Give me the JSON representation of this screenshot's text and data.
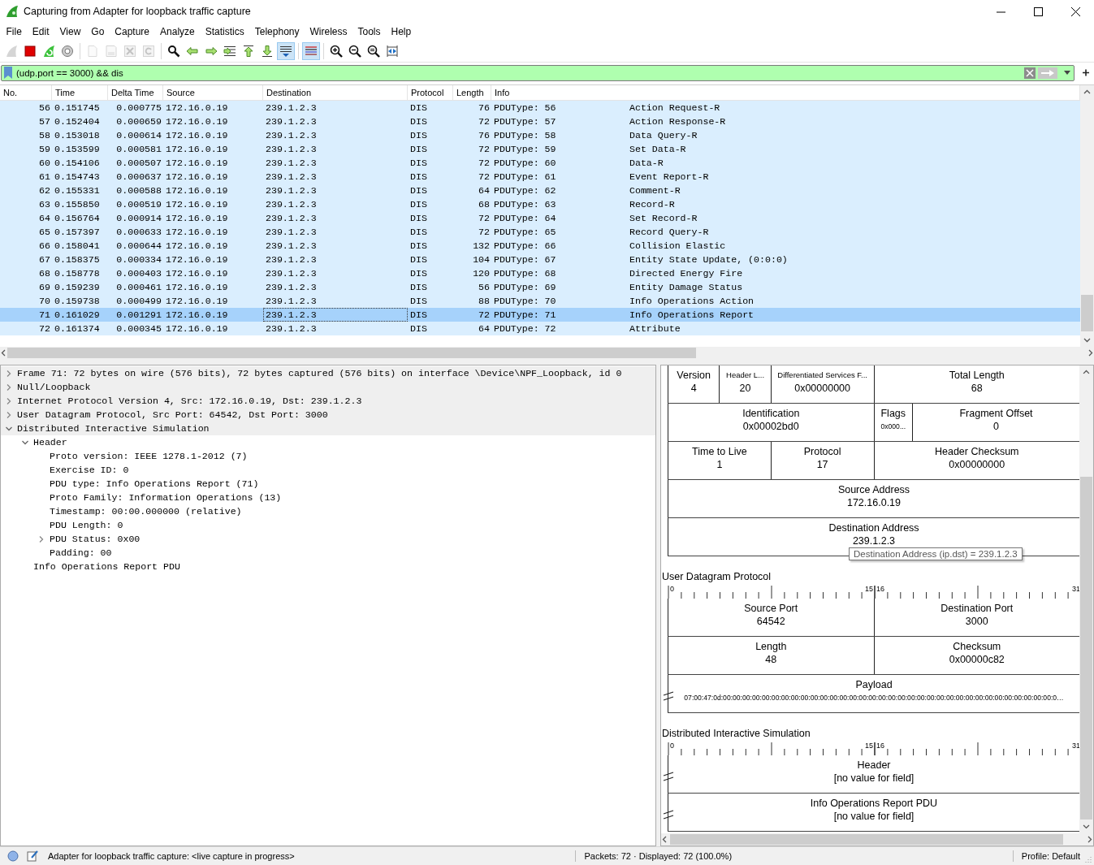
{
  "window": {
    "title": "Capturing from Adapter for loopback traffic capture"
  },
  "menu": [
    "File",
    "Edit",
    "View",
    "Go",
    "Capture",
    "Analyze",
    "Statistics",
    "Telephony",
    "Wireless",
    "Tools",
    "Help"
  ],
  "toolbar": [
    {
      "kind": "start",
      "disabled": true,
      "on": false
    },
    {
      "kind": "stop",
      "disabled": false,
      "on": false
    },
    {
      "kind": "restart",
      "disabled": false,
      "on": false
    },
    {
      "kind": "options",
      "disabled": false,
      "on": false
    },
    {
      "kind": "separator"
    },
    {
      "kind": "open",
      "disabled": true,
      "on": false
    },
    {
      "kind": "save",
      "disabled": true,
      "on": false
    },
    {
      "kind": "close",
      "disabled": true,
      "on": false
    },
    {
      "kind": "reload",
      "disabled": true,
      "on": false
    },
    {
      "kind": "separator"
    },
    {
      "kind": "find",
      "disabled": false,
      "on": false
    },
    {
      "kind": "back",
      "disabled": false,
      "on": false
    },
    {
      "kind": "forward",
      "disabled": false,
      "on": false
    },
    {
      "kind": "goto",
      "disabled": false,
      "on": false
    },
    {
      "kind": "first",
      "disabled": false,
      "on": false
    },
    {
      "kind": "last",
      "disabled": false,
      "on": false
    },
    {
      "kind": "autoscroll",
      "disabled": false,
      "on": true
    },
    {
      "kind": "separator"
    },
    {
      "kind": "colorize",
      "disabled": false,
      "on": true
    },
    {
      "kind": "separator"
    },
    {
      "kind": "zoom_in",
      "disabled": false,
      "on": false
    },
    {
      "kind": "zoom_out",
      "disabled": false,
      "on": false
    },
    {
      "kind": "zoom_normal",
      "disabled": false,
      "on": false
    },
    {
      "kind": "resize",
      "disabled": false,
      "on": false
    }
  ],
  "filter": {
    "value": "(udp.port == 3000) && dis"
  },
  "packet_list": {
    "columns": [
      "No.",
      "Time",
      "Delta Time",
      "Source",
      "Destination",
      "Protocol",
      "Length",
      "Info"
    ],
    "rows": [
      {
        "no": "56",
        "time": "0.151745",
        "delta_time": "0.000775",
        "source": "172.16.0.19",
        "destination": "239.1.2.3",
        "protocol": "DIS",
        "length": "76",
        "info_type": "PDUType: 56",
        "info_name": "Action Request-R",
        "selected": false
      },
      {
        "no": "57",
        "time": "0.152404",
        "delta_time": "0.000659",
        "source": "172.16.0.19",
        "destination": "239.1.2.3",
        "protocol": "DIS",
        "length": "72",
        "info_type": "PDUType: 57",
        "info_name": "Action Response-R",
        "selected": false
      },
      {
        "no": "58",
        "time": "0.153018",
        "delta_time": "0.000614",
        "source": "172.16.0.19",
        "destination": "239.1.2.3",
        "protocol": "DIS",
        "length": "76",
        "info_type": "PDUType: 58",
        "info_name": "Data Query-R",
        "selected": false
      },
      {
        "no": "59",
        "time": "0.153599",
        "delta_time": "0.000581",
        "source": "172.16.0.19",
        "destination": "239.1.2.3",
        "protocol": "DIS",
        "length": "72",
        "info_type": "PDUType: 59",
        "info_name": "Set Data-R",
        "selected": false
      },
      {
        "no": "60",
        "time": "0.154106",
        "delta_time": "0.000507",
        "source": "172.16.0.19",
        "destination": "239.1.2.3",
        "protocol": "DIS",
        "length": "72",
        "info_type": "PDUType: 60",
        "info_name": "Data-R",
        "selected": false
      },
      {
        "no": "61",
        "time": "0.154743",
        "delta_time": "0.000637",
        "source": "172.16.0.19",
        "destination": "239.1.2.3",
        "protocol": "DIS",
        "length": "72",
        "info_type": "PDUType: 61",
        "info_name": "Event Report-R",
        "selected": false
      },
      {
        "no": "62",
        "time": "0.155331",
        "delta_time": "0.000588",
        "source": "172.16.0.19",
        "destination": "239.1.2.3",
        "protocol": "DIS",
        "length": "64",
        "info_type": "PDUType: 62",
        "info_name": "Comment-R",
        "selected": false
      },
      {
        "no": "63",
        "time": "0.155850",
        "delta_time": "0.000519",
        "source": "172.16.0.19",
        "destination": "239.1.2.3",
        "protocol": "DIS",
        "length": "68",
        "info_type": "PDUType: 63",
        "info_name": "Record-R",
        "selected": false
      },
      {
        "no": "64",
        "time": "0.156764",
        "delta_time": "0.000914",
        "source": "172.16.0.19",
        "destination": "239.1.2.3",
        "protocol": "DIS",
        "length": "72",
        "info_type": "PDUType: 64",
        "info_name": "Set Record-R",
        "selected": false
      },
      {
        "no": "65",
        "time": "0.157397",
        "delta_time": "0.000633",
        "source": "172.16.0.19",
        "destination": "239.1.2.3",
        "protocol": "DIS",
        "length": "72",
        "info_type": "PDUType: 65",
        "info_name": "Record Query-R",
        "selected": false
      },
      {
        "no": "66",
        "time": "0.158041",
        "delta_time": "0.000644",
        "source": "172.16.0.19",
        "destination": "239.1.2.3",
        "protocol": "DIS",
        "length": "132",
        "info_type": "PDUType: 66",
        "info_name": "Collision Elastic",
        "selected": false
      },
      {
        "no": "67",
        "time": "0.158375",
        "delta_time": "0.000334",
        "source": "172.16.0.19",
        "destination": "239.1.2.3",
        "protocol": "DIS",
        "length": "104",
        "info_type": "PDUType: 67",
        "info_name": "Entity State Update, (0:0:0)",
        "selected": false
      },
      {
        "no": "68",
        "time": "0.158778",
        "delta_time": "0.000403",
        "source": "172.16.0.19",
        "destination": "239.1.2.3",
        "protocol": "DIS",
        "length": "120",
        "info_type": "PDUType: 68",
        "info_name": "Directed Energy Fire",
        "selected": false
      },
      {
        "no": "69",
        "time": "0.159239",
        "delta_time": "0.000461",
        "source": "172.16.0.19",
        "destination": "239.1.2.3",
        "protocol": "DIS",
        "length": "56",
        "info_type": "PDUType: 69",
        "info_name": "Entity Damage Status",
        "selected": false
      },
      {
        "no": "70",
        "time": "0.159738",
        "delta_time": "0.000499",
        "source": "172.16.0.19",
        "destination": "239.1.2.3",
        "protocol": "DIS",
        "length": "88",
        "info_type": "PDUType: 70",
        "info_name": "Info Operations Action",
        "selected": false
      },
      {
        "no": "71",
        "time": "0.161029",
        "delta_time": "0.001291",
        "source": "172.16.0.19",
        "destination": "239.1.2.3",
        "protocol": "DIS",
        "length": "72",
        "info_type": "PDUType: 71",
        "info_name": "Info Operations Report",
        "selected": true
      },
      {
        "no": "72",
        "time": "0.161374",
        "delta_time": "0.000345",
        "source": "172.16.0.19",
        "destination": "239.1.2.3",
        "protocol": "DIS",
        "length": "64",
        "info_type": "PDUType: 72",
        "info_name": "Attribute",
        "selected": false
      }
    ]
  },
  "details": [
    {
      "text": "Frame 71: 72 bytes on wire (576 bits), 72 bytes captured (576 bits) on interface \\Device\\NPF_Loopback, id 0",
      "expanded": false
    },
    {
      "text": "Null/Loopback",
      "expanded": false
    },
    {
      "text": "Internet Protocol Version 4, Src: 172.16.0.19, Dst: 239.1.2.3",
      "expanded": false
    },
    {
      "text": "User Datagram Protocol, Src Port: 64542, Dst Port: 3000",
      "expanded": false
    },
    {
      "text": "Distributed Interactive Simulation",
      "expanded": true,
      "children": [
        {
          "text": "Header",
          "expanded": true,
          "children": [
            {
              "text": "Proto version: IEEE 1278.1-2012 (7)"
            },
            {
              "text": "Exercise ID: 0"
            },
            {
              "text": "PDU type: Info Operations Report (71)"
            },
            {
              "text": "Proto Family: Information Operations (13)"
            },
            {
              "text": "Timestamp: 00:00.000000 (relative)"
            },
            {
              "text": "PDU Length: 0"
            },
            {
              "text": "PDU Status: 0x00",
              "expanded": false
            },
            {
              "text": "Padding: 00"
            }
          ]
        },
        {
          "text": "Info Operations Report PDU"
        }
      ]
    }
  ],
  "diagram": {
    "sections": [
      {
        "rows": [
          {
            "kind": "fixed",
            "fields": [
              {
                "name": "Version",
                "value": "4",
                "kind": "nibble"
              },
              {
                "name": "Header L...",
                "value": "20",
                "kind": "nibble",
                "small": true
              },
              {
                "name": "Differentiated Services F...",
                "value": "0x00000000",
                "kind": "byte",
                "small": true
              },
              {
                "name": "Total Length",
                "value": "68",
                "kind": "half"
              }
            ]
          },
          {
            "kind": "fixed",
            "fields": [
              {
                "name": "Identification",
                "value": "0x00002bd0",
                "kind": "half"
              },
              {
                "name": "Flags",
                "value": "0x000...",
                "kind": "flags",
                "small_value": true
              },
              {
                "name": "Fragment Offset",
                "value": "0",
                "kind": "offset"
              }
            ]
          },
          {
            "kind": "fixed",
            "fields": [
              {
                "name": "Time to Live",
                "value": "1",
                "kind": "byte"
              },
              {
                "name": "Protocol",
                "value": "17",
                "kind": "byte"
              },
              {
                "name": "Header Checksum",
                "value": "0x00000000",
                "kind": "half"
              }
            ]
          },
          {
            "kind": "fixed",
            "fields": [
              {
                "name": "Source Address",
                "value": "172.16.0.19",
                "kind": "word"
              }
            ]
          },
          {
            "kind": "fixed",
            "fields": [
              {
                "name": "Destination Address",
                "value": "239.1.2.3",
                "kind": "word"
              }
            ]
          }
        ]
      },
      {
        "title": "User Datagram Protocol",
        "ruler": [
          "0",
          "15",
          "16",
          "31"
        ],
        "rows": [
          {
            "kind": "fixed",
            "fields": [
              {
                "name": "Source Port",
                "value": "64542",
                "kind": "half"
              },
              {
                "name": "Destination Port",
                "value": "3000",
                "kind": "half"
              }
            ]
          },
          {
            "kind": "fixed",
            "fields": [
              {
                "name": "Length",
                "value": "48",
                "kind": "half"
              },
              {
                "name": "Checksum",
                "value": "0x00000c82",
                "kind": "half"
              }
            ]
          },
          {
            "kind": "variable",
            "fields": [
              {
                "name": "Payload",
                "value": "07:00:47:0d:00:00:00:00:00:00:00:00:00:00:00:00:00:00:00:00:00:00:00:00:00:00:00:00:00:00:00:00:00:00:00:00:00:00:0…",
                "kind": "word",
                "small_value": true
              }
            ]
          }
        ]
      },
      {
        "title": "Distributed Interactive Simulation",
        "ruler": [
          "0",
          "15",
          "16",
          "31"
        ],
        "rows": [
          {
            "kind": "variable",
            "fields": [
              {
                "name": "Header",
                "value": "[no value for field]",
                "kind": "word"
              }
            ]
          },
          {
            "kind": "variable",
            "fields": [
              {
                "name": "Info Operations Report PDU",
                "value": "[no value for field]",
                "kind": "word"
              }
            ]
          }
        ]
      }
    ],
    "tooltip": {
      "text": "Destination Address (ip.dst) = 239.1.2.3"
    }
  },
  "status_bar": {
    "capture": "Adapter for loopback traffic capture: <live capture in progress>",
    "packets": "Packets: 72 · Displayed: 72 (100.0%)",
    "profile": "Profile: Default"
  }
}
